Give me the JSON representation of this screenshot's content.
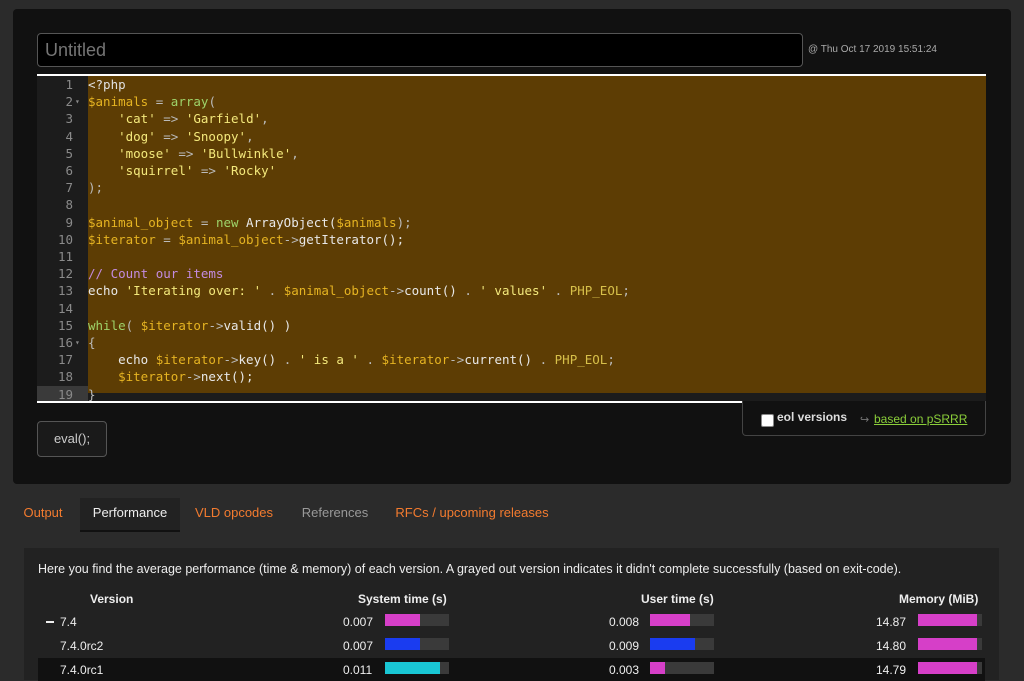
{
  "editor": {
    "title_placeholder": "Untitled",
    "timestamp": "@ Thu Oct 17 2019 15:51:24",
    "lines": [
      {
        "n": "1",
        "fold": "",
        "tokens": [
          {
            "c": "t-php",
            "t": "<?php"
          }
        ]
      },
      {
        "n": "2",
        "fold": "▾",
        "tokens": [
          {
            "c": "t-var",
            "t": "$animals"
          },
          {
            "c": "t-op",
            "t": " = "
          },
          {
            "c": "t-fn",
            "t": "array"
          },
          {
            "c": "t-op",
            "t": "("
          }
        ]
      },
      {
        "n": "3",
        "fold": "",
        "tokens": [
          {
            "c": "t-plain",
            "t": "    "
          },
          {
            "c": "t-str",
            "t": "'cat'"
          },
          {
            "c": "t-op",
            "t": " => "
          },
          {
            "c": "t-str",
            "t": "'Garfield'"
          },
          {
            "c": "t-op",
            "t": ","
          }
        ]
      },
      {
        "n": "4",
        "fold": "",
        "tokens": [
          {
            "c": "t-plain",
            "t": "    "
          },
          {
            "c": "t-str",
            "t": "'dog'"
          },
          {
            "c": "t-op",
            "t": " => "
          },
          {
            "c": "t-str",
            "t": "'Snoopy'"
          },
          {
            "c": "t-op",
            "t": ","
          }
        ]
      },
      {
        "n": "5",
        "fold": "",
        "tokens": [
          {
            "c": "t-plain",
            "t": "    "
          },
          {
            "c": "t-str",
            "t": "'moose'"
          },
          {
            "c": "t-op",
            "t": " => "
          },
          {
            "c": "t-str",
            "t": "'Bullwinkle'"
          },
          {
            "c": "t-op",
            "t": ","
          }
        ]
      },
      {
        "n": "6",
        "fold": "",
        "tokens": [
          {
            "c": "t-plain",
            "t": "    "
          },
          {
            "c": "t-str",
            "t": "'squirrel'"
          },
          {
            "c": "t-op",
            "t": " => "
          },
          {
            "c": "t-str",
            "t": "'Rocky'"
          }
        ]
      },
      {
        "n": "7",
        "fold": "",
        "tokens": [
          {
            "c": "t-op",
            "t": ");"
          }
        ]
      },
      {
        "n": "8",
        "fold": "",
        "tokens": []
      },
      {
        "n": "9",
        "fold": "",
        "tokens": [
          {
            "c": "t-var",
            "t": "$animal_object"
          },
          {
            "c": "t-op",
            "t": " = "
          },
          {
            "c": "t-kw",
            "t": "new"
          },
          {
            "c": "t-plain",
            "t": " ArrayObject("
          },
          {
            "c": "t-var",
            "t": "$animals"
          },
          {
            "c": "t-op",
            "t": ");"
          }
        ]
      },
      {
        "n": "10",
        "fold": "",
        "tokens": [
          {
            "c": "t-var",
            "t": "$iterator"
          },
          {
            "c": "t-op",
            "t": " = "
          },
          {
            "c": "t-var",
            "t": "$animal_object"
          },
          {
            "c": "t-op",
            "t": "->"
          },
          {
            "c": "t-plain",
            "t": "getIterator();"
          }
        ]
      },
      {
        "n": "11",
        "fold": "",
        "tokens": []
      },
      {
        "n": "12",
        "fold": "",
        "tokens": [
          {
            "c": "t-com",
            "t": "// Count our items"
          }
        ]
      },
      {
        "n": "13",
        "fold": "",
        "tokens": [
          {
            "c": "t-plain",
            "t": "echo "
          },
          {
            "c": "t-str",
            "t": "'Iterating over: '"
          },
          {
            "c": "t-op",
            "t": " . "
          },
          {
            "c": "t-var",
            "t": "$animal_object"
          },
          {
            "c": "t-op",
            "t": "->"
          },
          {
            "c": "t-plain",
            "t": "count()"
          },
          {
            "c": "t-op",
            "t": " . "
          },
          {
            "c": "t-str",
            "t": "' values'"
          },
          {
            "c": "t-op",
            "t": " . "
          },
          {
            "c": "t-const",
            "t": "PHP_EOL"
          },
          {
            "c": "t-op",
            "t": ";"
          }
        ]
      },
      {
        "n": "14",
        "fold": "",
        "tokens": []
      },
      {
        "n": "15",
        "fold": "",
        "tokens": [
          {
            "c": "t-kw",
            "t": "while"
          },
          {
            "c": "t-op",
            "t": "( "
          },
          {
            "c": "t-var",
            "t": "$iterator"
          },
          {
            "c": "t-op",
            "t": "->"
          },
          {
            "c": "t-plain",
            "t": "valid() )"
          }
        ]
      },
      {
        "n": "16",
        "fold": "▾",
        "tokens": [
          {
            "c": "t-op",
            "t": "{"
          }
        ]
      },
      {
        "n": "17",
        "fold": "",
        "tokens": [
          {
            "c": "t-plain",
            "t": "    echo "
          },
          {
            "c": "t-var",
            "t": "$iterator"
          },
          {
            "c": "t-op",
            "t": "->"
          },
          {
            "c": "t-plain",
            "t": "key()"
          },
          {
            "c": "t-op",
            "t": " . "
          },
          {
            "c": "t-str",
            "t": "' is a '"
          },
          {
            "c": "t-op",
            "t": " . "
          },
          {
            "c": "t-var",
            "t": "$iterator"
          },
          {
            "c": "t-op",
            "t": "->"
          },
          {
            "c": "t-plain",
            "t": "current()"
          },
          {
            "c": "t-op",
            "t": " . "
          },
          {
            "c": "t-const",
            "t": "PHP_EOL"
          },
          {
            "c": "t-op",
            "t": ";"
          }
        ]
      },
      {
        "n": "18",
        "fold": "",
        "tokens": [
          {
            "c": "t-plain",
            "t": "    "
          },
          {
            "c": "t-var",
            "t": "$iterator"
          },
          {
            "c": "t-op",
            "t": "->"
          },
          {
            "c": "t-plain",
            "t": "next();"
          }
        ]
      },
      {
        "n": "19",
        "fold": "",
        "tokens": [
          {
            "c": "t-op",
            "t": "}"
          }
        ]
      }
    ]
  },
  "options": {
    "eol_label": "eol versions",
    "psrrr_link": "based on pSRRR"
  },
  "eval_label": "eval();",
  "tabs": [
    {
      "label": "Output",
      "state": "normal"
    },
    {
      "label": "Performance",
      "state": "active"
    },
    {
      "label": "VLD opcodes",
      "state": "normal"
    },
    {
      "label": "References",
      "state": "disabled"
    },
    {
      "label": "RFCs / upcoming releases",
      "state": "normal"
    }
  ],
  "performance": {
    "description": "Here you find the average performance (time & memory) of each version. A grayed out version indicates it didn't complete successfully (based on exit-code).",
    "headers": {
      "version": "Version",
      "system": "System time (s)",
      "user": "User time (s)",
      "memory": "Memory (MiB)"
    },
    "rows": [
      {
        "version": "7.4",
        "system": "0.007",
        "system_frac": 0.55,
        "system_color": "#d63fc8",
        "user": "0.008",
        "user_frac": 0.62,
        "user_color": "#d63fc8",
        "memory": "14.87",
        "memory_frac": 0.92,
        "memory_color": "#d63fc8"
      },
      {
        "version": "7.4.0rc2",
        "system": "0.007",
        "system_frac": 0.55,
        "system_color": "#1a3cf0",
        "user": "0.009",
        "user_frac": 0.7,
        "user_color": "#1a3cf0",
        "memory": "14.80",
        "memory_frac": 0.92,
        "memory_color": "#d63fc8"
      },
      {
        "version": "7.4.0rc1",
        "system": "0.011",
        "system_frac": 0.86,
        "system_color": "#19c6d4",
        "user": "0.003",
        "user_frac": 0.24,
        "user_color": "#d63fc8",
        "memory": "14.79",
        "memory_frac": 0.92,
        "memory_color": "#d63fc8"
      }
    ]
  }
}
